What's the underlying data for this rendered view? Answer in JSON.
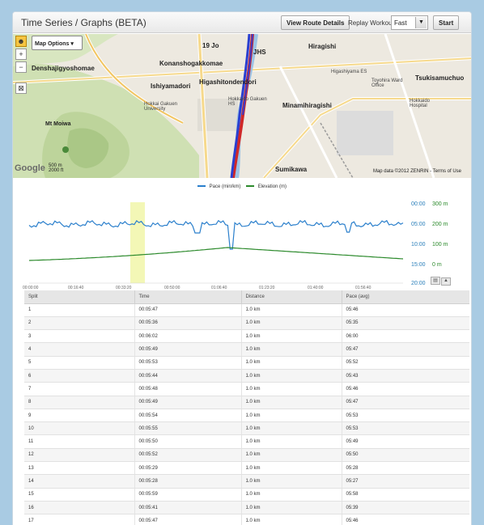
{
  "header": {
    "title": "Time Series / Graphs (BETA)",
    "route_button": "View Route Details",
    "replay_label": "Replay Workout:",
    "replay_speed": "Fast",
    "start_button": "Start"
  },
  "map": {
    "options_button": "Map Options",
    "google_logo": "Google",
    "scale_top": "500 m",
    "scale_bottom": "2000 ft",
    "data_credit": "Map data ©2012 ZENRIN - Terms of Use",
    "labels": [
      "Denshajigyoshomae",
      "Konanshogakkomae",
      "Ishiyamadori",
      "Higashitondendori",
      "Hokkai Gakuen University",
      "Hokkaido Gakuen HS",
      "Minamihiragishi",
      "Higashiyama ES",
      "Toyohira Ward Office",
      "Hokkaido Hospital",
      "Tsukisamuchuo",
      "Mt Moiwa",
      "Hiragishi",
      "Sumikawa",
      "19 Jo",
      "JHS"
    ]
  },
  "chart_data": {
    "type": "line",
    "series": [
      {
        "name": "Pace (min/km)",
        "color": "#2a7fcc"
      },
      {
        "name": "Elevation (m)",
        "color": "#2c8a2c"
      }
    ],
    "y_left_ticks": [
      "00:00",
      "05:00",
      "10:00",
      "15:00",
      "20:00"
    ],
    "y_right_ticks": [
      "300 m",
      "200 m",
      "100 m",
      "0 m"
    ],
    "x_ticks": [
      "00:00:00",
      "00:16:40",
      "00:33:20",
      "00:50:00",
      "01:06:40",
      "01:23:20",
      "01:40:00",
      "01:56:40"
    ],
    "highlight": "00:33:20–00:41:00"
  },
  "table": {
    "headers": [
      "Split",
      "Time",
      "Distance",
      "Pace (avg)"
    ],
    "rows": [
      [
        "1",
        "00:05:47",
        "1.0 km",
        "05:46"
      ],
      [
        "2",
        "00:05:36",
        "1.0 km",
        "05:35"
      ],
      [
        "3",
        "00:06:02",
        "1.0 km",
        "06:00"
      ],
      [
        "4",
        "00:05:49",
        "1.0 km",
        "05:47"
      ],
      [
        "5",
        "00:05:53",
        "1.0 km",
        "05:52"
      ],
      [
        "6",
        "00:05:44",
        "1.0 km",
        "05:43"
      ],
      [
        "7",
        "00:05:48",
        "1.0 km",
        "05:46"
      ],
      [
        "8",
        "00:05:49",
        "1.0 km",
        "05:47"
      ],
      [
        "9",
        "00:05:54",
        "1.0 km",
        "05:53"
      ],
      [
        "10",
        "00:05:55",
        "1.0 km",
        "05:53"
      ],
      [
        "11",
        "00:05:50",
        "1.0 km",
        "05:49"
      ],
      [
        "12",
        "00:05:52",
        "1.0 km",
        "05:50"
      ],
      [
        "13",
        "00:05:29",
        "1.0 km",
        "05:28"
      ],
      [
        "14",
        "00:05:28",
        "1.0 km",
        "05:27"
      ],
      [
        "15",
        "00:05:59",
        "1.0 km",
        "05:58"
      ],
      [
        "16",
        "00:05:41",
        "1.0 km",
        "05:39"
      ],
      [
        "17",
        "00:05:47",
        "1.0 km",
        "05:46"
      ]
    ]
  }
}
